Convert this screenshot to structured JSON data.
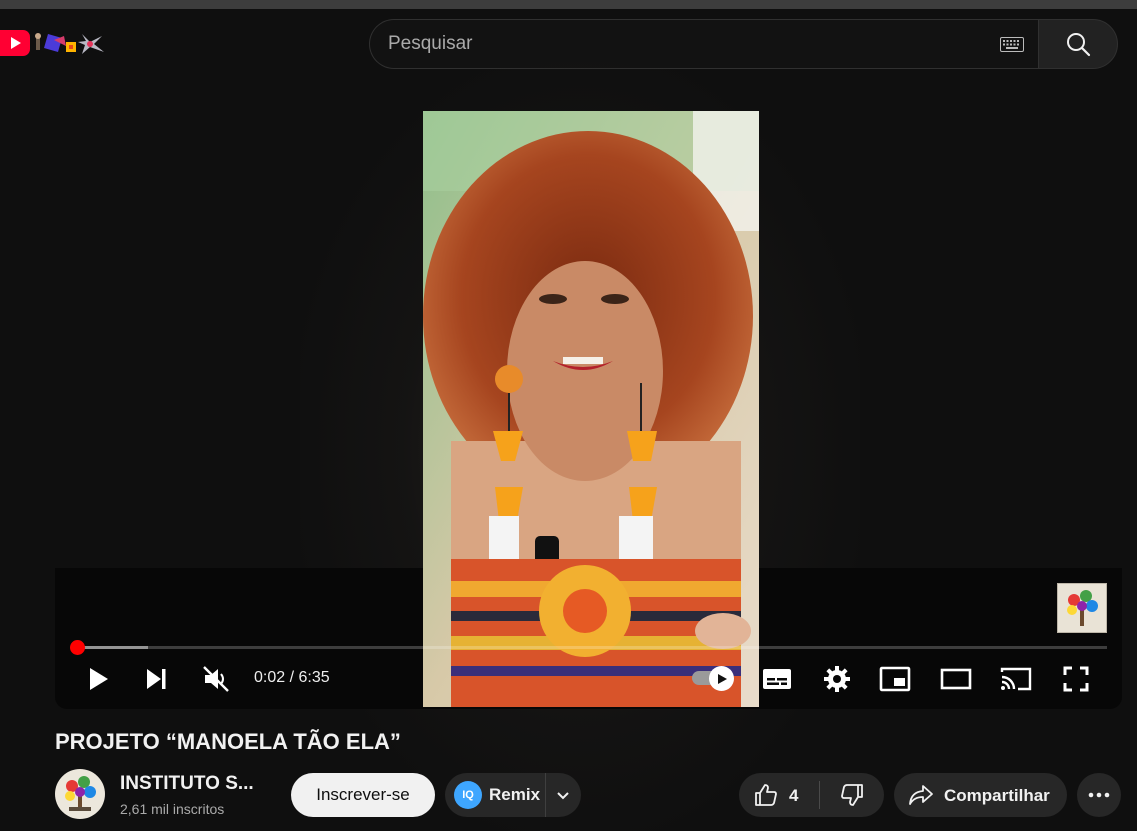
{
  "search": {
    "placeholder": "Pesquisar"
  },
  "player": {
    "time_current": "0:02",
    "time_total": "6:35",
    "time_display": "0:02 / 6:35",
    "progress_fraction": 0.005,
    "muted": true,
    "autoplay": true
  },
  "video": {
    "title": "PROJETO “MANOELA TÃO ELA”"
  },
  "channel": {
    "name": "INSTITUTO S...",
    "subscribers": "2,61 mil inscritos"
  },
  "actions": {
    "subscribe_label": "Inscrever-se",
    "remix_icon_text": "IQ",
    "remix_label": "Remix",
    "like_count": "4",
    "share_label": "Compartilhar"
  },
  "colors": {
    "background": "#0f0f0f",
    "accent_red": "#ff0000",
    "button_bg": "#272727",
    "subscribe_bg": "#f1f1f1",
    "remix_blue": "#3ea6ff"
  }
}
